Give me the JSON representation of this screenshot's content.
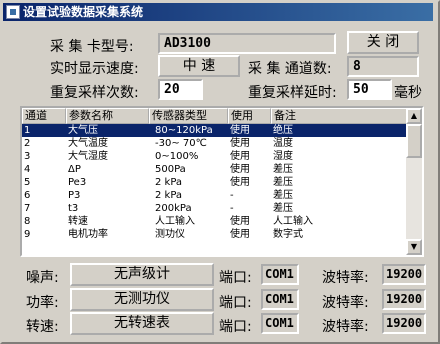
{
  "window": {
    "title": "设置试验数据采集系统"
  },
  "top": {
    "card_label": "采 集 卡型号:",
    "card_model": "AD3100",
    "close_label": "关 闭",
    "speed_label": "实时显示速度:",
    "speed_value": "中 速",
    "channels_label": "采 集 通道数:",
    "channels_value": "8",
    "repeat_count_label": "重复采样次数:",
    "repeat_count_value": "20",
    "repeat_delay_label": "重复采样延时:",
    "repeat_delay_value": "50",
    "delay_unit": "毫秒"
  },
  "table": {
    "headers": [
      "通道",
      "参数名称",
      "传感器类型",
      "使用",
      "备注"
    ],
    "rows": [
      [
        "1",
        "大气压",
        "80~120kPa",
        "使用",
        "绝压"
      ],
      [
        "2",
        "大气温度",
        "-30~ 70℃",
        "使用",
        "温度"
      ],
      [
        "3",
        "大气湿度",
        "0~100%",
        "使用",
        "湿度"
      ],
      [
        "4",
        "ΔP",
        "500Pa",
        "使用",
        "差压"
      ],
      [
        "5",
        "Pe3",
        "2 kPa",
        "使用",
        "差压"
      ],
      [
        "6",
        "P3",
        "2 kPa",
        "-",
        "差压"
      ],
      [
        "7",
        "t3",
        "200kPa",
        "-",
        "差压"
      ],
      [
        "8",
        "转速",
        "人工输入",
        "使用",
        "人工输入"
      ],
      [
        "9",
        "电机功率",
        "测功仪",
        "使用",
        "数字式"
      ]
    ],
    "selected_row": 0
  },
  "bottom": {
    "rows": [
      {
        "label": "噪声:",
        "button": "无声级计",
        "port_label": "端口:",
        "port": "COM1",
        "baud_label": "波特率:",
        "baud": "19200"
      },
      {
        "label": "功率:",
        "button": "无测功仪",
        "port_label": "端口:",
        "port": "COM1",
        "baud_label": "波特率:",
        "baud": "19200"
      },
      {
        "label": "转速:",
        "button": "无转速表",
        "port_label": "端口:",
        "port": "COM1",
        "baud_label": "波特率:",
        "baud": "19200"
      }
    ]
  },
  "icons": {
    "app": "app-icon",
    "scroll_up": "scroll-up-icon",
    "scroll_down": "scroll-down-icon"
  }
}
